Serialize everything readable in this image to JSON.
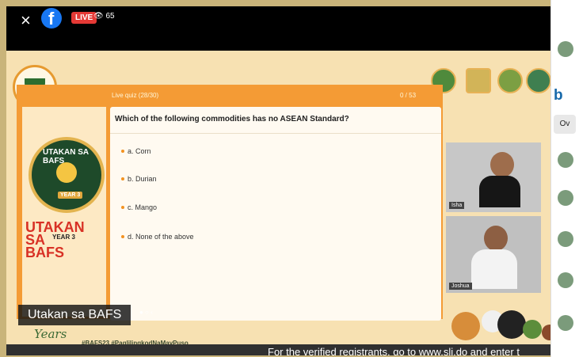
{
  "live": {
    "badge": "LIVE",
    "viewers": "65"
  },
  "quiz": {
    "header": "Live quiz (28/30)",
    "progress": "0 / 53",
    "question": "Which of the following commodities has no ASEAN Standard?",
    "options": [
      "a. Corn",
      "b. Durian",
      "c. Mango",
      "d. None of the above"
    ]
  },
  "brand": {
    "badge_text": "UTAKAN SA BAFS",
    "year_badge": "YEAR 3",
    "title": "UTAKAN SA",
    "title2": "BAFS",
    "title_year": "YEAR 3"
  },
  "videos": [
    {
      "name": "Isha"
    },
    {
      "name": "Joshua"
    }
  ],
  "overlay_title": "Utakan sa BAFS",
  "bottom": {
    "hashtags": "#BAFS23  #PaglilingkodNaMayPuso",
    "logo_text": "Years",
    "ticker": "For the verified registrants, go to www.sli.do and enter t"
  },
  "sidebar": {
    "brand": "b",
    "tab": "Ov"
  }
}
